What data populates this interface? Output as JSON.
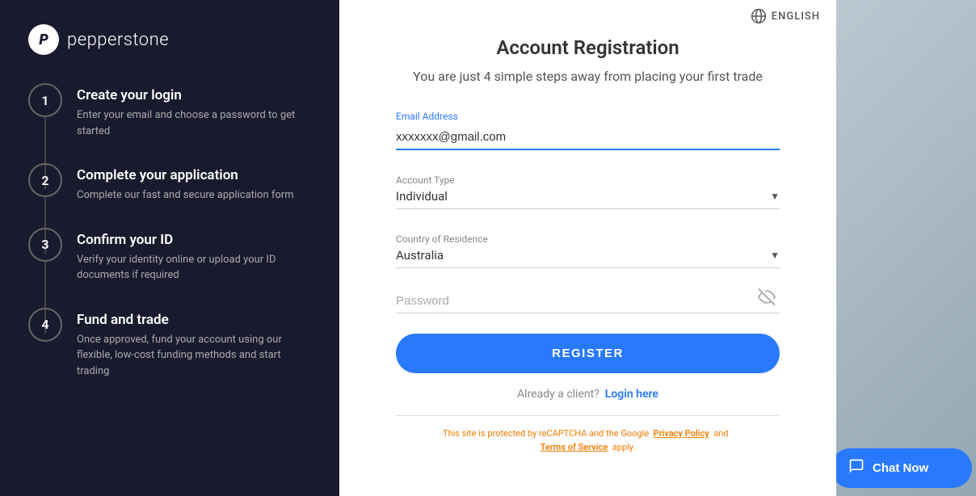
{
  "left": {
    "logo_letter": "P",
    "logo_name": "pepperstone",
    "steps": [
      {
        "number": "1",
        "title": "Create your login",
        "description": "Enter your email and choose a password to get started"
      },
      {
        "number": "2",
        "title": "Complete your application",
        "description": "Complete our fast and secure application form"
      },
      {
        "number": "3",
        "title": "Confirm your ID",
        "description": "Verify your identity online or upload your ID documents if required"
      },
      {
        "number": "4",
        "title": "Fund and trade",
        "description": "Once approved, fund your account using our flexible, low-cost funding methods and start trading"
      }
    ]
  },
  "form": {
    "lang_label": "ENGLISH",
    "title": "Account Registration",
    "subtitle": "You are just 4 simple steps away from placing your first trade",
    "email_label": "Email Address",
    "email_value": "xxxxxxx@gmail.com",
    "account_type_label": "Account Type",
    "account_type_value": "Individual",
    "country_label": "Country of Residence",
    "country_value": "Australia",
    "password_placeholder": "Password",
    "register_label": "REGISTER",
    "already_client": "Already a client?",
    "login_link": "Login here",
    "recaptcha_text": "This site is protected by reCAPTCHA and the Google",
    "privacy_link": "Privacy Policy",
    "and_text": "and",
    "tos_text": "Terms of Service",
    "apply_text": "apply."
  },
  "chat": {
    "label": "Chat Now"
  }
}
